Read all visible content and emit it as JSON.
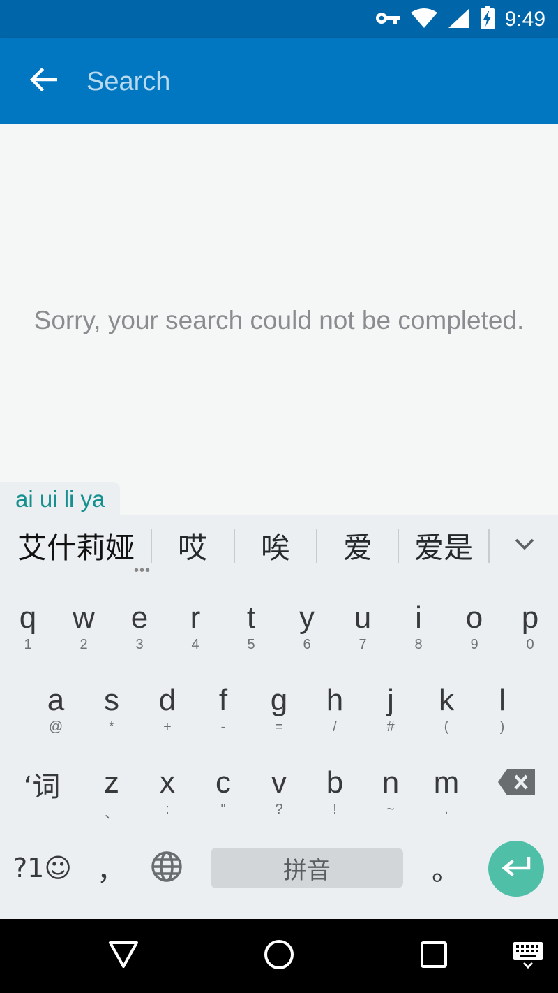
{
  "status_bar": {
    "time": "9:49",
    "icons": [
      "vpn-key-icon",
      "wifi-icon",
      "cell-signal-icon",
      "battery-charging-icon"
    ]
  },
  "app_bar": {
    "back_icon": "arrow-back-icon",
    "search_placeholder": "Search",
    "background": "#0177c1"
  },
  "content": {
    "message": "Sorry, your search could not be completed."
  },
  "ime": {
    "composing_text": "ai ui li ya",
    "candidates": [
      "艾什莉娅",
      "哎",
      "唉",
      "爱",
      "爱是"
    ],
    "more_icon": "chevron-down-icon",
    "rows": [
      [
        {
          "main": "q",
          "sub": "1"
        },
        {
          "main": "w",
          "sub": "2"
        },
        {
          "main": "e",
          "sub": "3"
        },
        {
          "main": "r",
          "sub": "4"
        },
        {
          "main": "t",
          "sub": "5"
        },
        {
          "main": "y",
          "sub": "6"
        },
        {
          "main": "u",
          "sub": "7"
        },
        {
          "main": "i",
          "sub": "8"
        },
        {
          "main": "o",
          "sub": "9"
        },
        {
          "main": "p",
          "sub": "0"
        }
      ],
      [
        {
          "main": "a",
          "sub": "@"
        },
        {
          "main": "s",
          "sub": "*"
        },
        {
          "main": "d",
          "sub": "+"
        },
        {
          "main": "f",
          "sub": "-"
        },
        {
          "main": "g",
          "sub": "="
        },
        {
          "main": "h",
          "sub": "/"
        },
        {
          "main": "j",
          "sub": "#"
        },
        {
          "main": "k",
          "sub": "("
        },
        {
          "main": "l",
          "sub": ")"
        }
      ],
      [
        {
          "main": "z",
          "sub": "、"
        },
        {
          "main": "x",
          "sub": ":"
        },
        {
          "main": "c",
          "sub": "\""
        },
        {
          "main": "v",
          "sub": "?"
        },
        {
          "main": "b",
          "sub": "!"
        },
        {
          "main": "n",
          "sub": "~"
        },
        {
          "main": "m",
          "sub": "."
        }
      ]
    ],
    "word_key_label": "‘词",
    "symbols_key_label": "?1☺",
    "comma_label": "，",
    "period_label": "。",
    "space_label": "拼音",
    "accent_color": "#4fbfa8"
  },
  "nav_bar": {
    "icons": [
      "back-triangle-icon",
      "home-circle-icon",
      "recents-square-icon",
      "keyboard-switch-icon"
    ]
  }
}
